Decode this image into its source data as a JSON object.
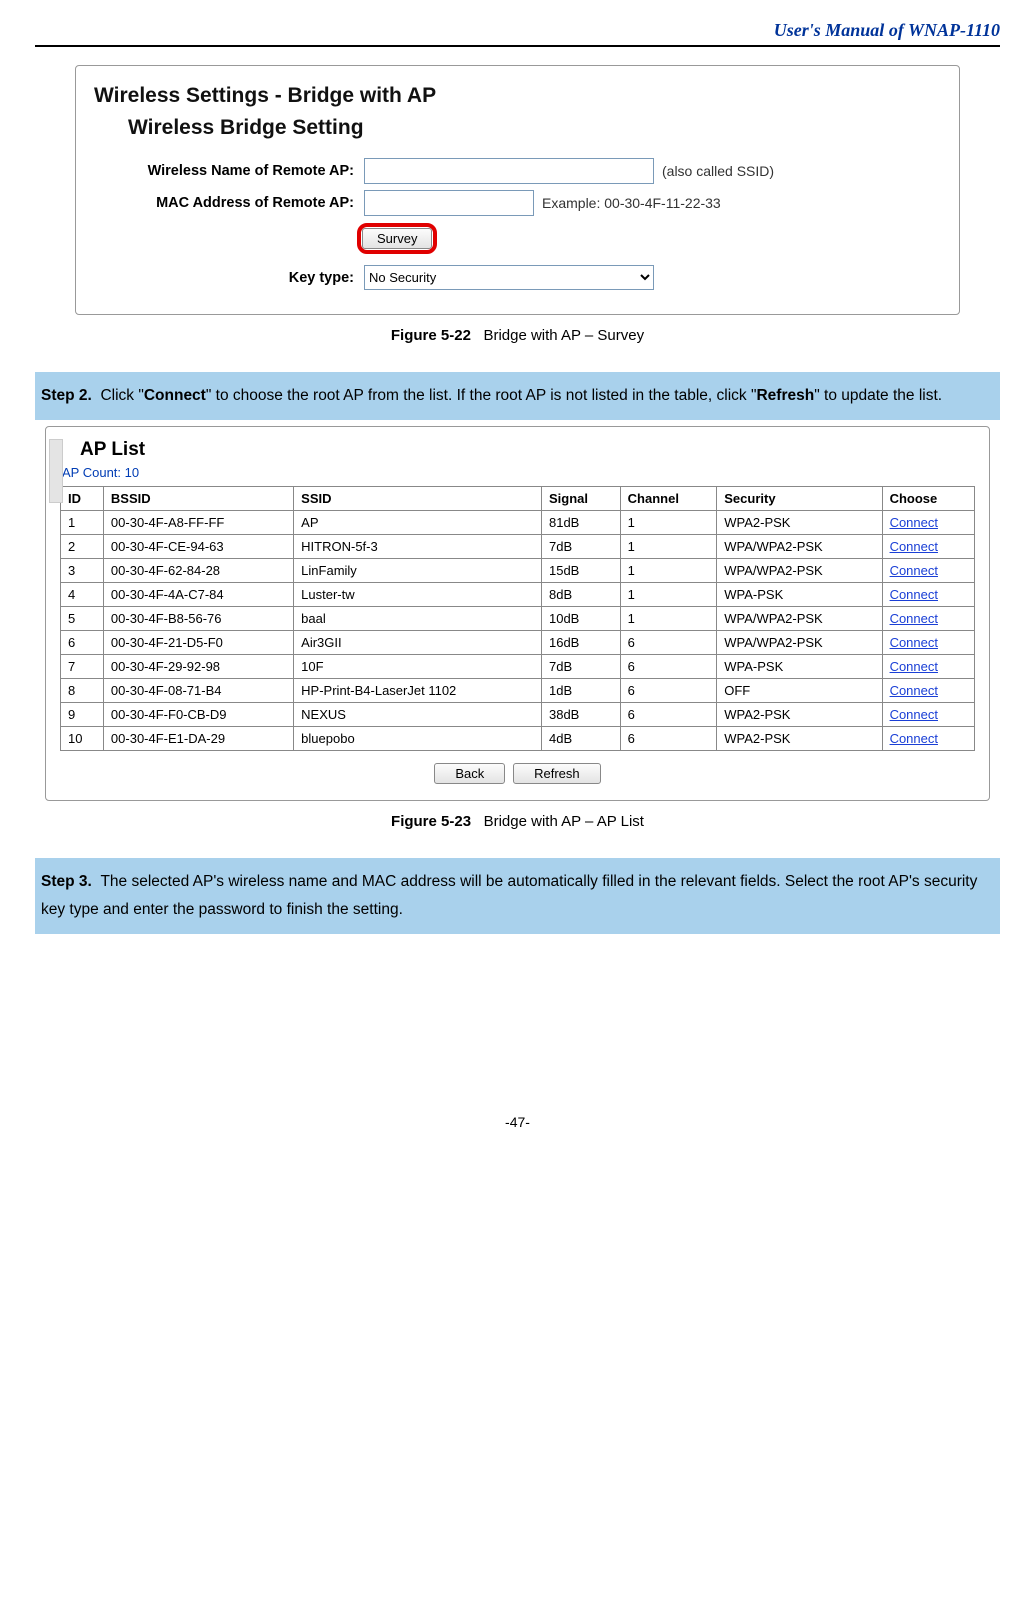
{
  "header": {
    "title": "User's Manual of WNAP-1110"
  },
  "panel1": {
    "title1": "Wireless Settings - Bridge with AP",
    "title2": "Wireless Bridge Setting",
    "row_ssid_label": "Wireless Name of Remote AP:",
    "row_ssid_hint": "(also called SSID)",
    "row_mac_label": "MAC Address of Remote AP:",
    "row_mac_hint": "Example: 00-30-4F-11-22-33",
    "survey_btn": "Survey",
    "row_key_label": "Key type:",
    "key_value": "No Security"
  },
  "caption1": {
    "label": "Figure 5-22",
    "desc": "Bridge with AP – Survey"
  },
  "step2": {
    "label": "Step 2.",
    "t1": "Click \"",
    "b1": "Connect",
    "t2": "\" to choose the root AP from the list. If the root AP is not listed in the table, click \"",
    "b2": "Refresh",
    "t3": "\" to update the list."
  },
  "panel2": {
    "title": "AP List",
    "count": "AP Count: 10",
    "headers": {
      "id": "ID",
      "bssid": "BSSID",
      "ssid": "SSID",
      "signal": "Signal",
      "channel": "Channel",
      "security": "Security",
      "choose": "Choose"
    },
    "rows": [
      {
        "id": "1",
        "bssid": "00-30-4F-A8-FF-FF",
        "ssid": "AP",
        "signal": "81dB",
        "channel": "1",
        "security": "WPA2-PSK",
        "choose": "Connect"
      },
      {
        "id": "2",
        "bssid": "00-30-4F-CE-94-63",
        "ssid": "HITRON-5f-3",
        "signal": "7dB",
        "channel": "1",
        "security": "WPA/WPA2-PSK",
        "choose": "Connect"
      },
      {
        "id": "3",
        "bssid": "00-30-4F-62-84-28",
        "ssid": "LinFamily",
        "signal": "15dB",
        "channel": "1",
        "security": "WPA/WPA2-PSK",
        "choose": "Connect"
      },
      {
        "id": "4",
        "bssid": "00-30-4F-4A-C7-84",
        "ssid": "Luster-tw",
        "signal": "8dB",
        "channel": "1",
        "security": "WPA-PSK",
        "choose": "Connect"
      },
      {
        "id": "5",
        "bssid": "00-30-4F-B8-56-76",
        "ssid": "baal",
        "signal": "10dB",
        "channel": "1",
        "security": "WPA/WPA2-PSK",
        "choose": "Connect"
      },
      {
        "id": "6",
        "bssid": "00-30-4F-21-D5-F0",
        "ssid": "Air3GII",
        "signal": "16dB",
        "channel": "6",
        "security": "WPA/WPA2-PSK",
        "choose": "Connect"
      },
      {
        "id": "7",
        "bssid": "00-30-4F-29-92-98",
        "ssid": "10F",
        "signal": "7dB",
        "channel": "6",
        "security": "WPA-PSK",
        "choose": "Connect"
      },
      {
        "id": "8",
        "bssid": "00-30-4F-08-71-B4",
        "ssid": "HP-Print-B4-LaserJet 1102",
        "signal": "1dB",
        "channel": "6",
        "security": "OFF",
        "choose": "Connect"
      },
      {
        "id": "9",
        "bssid": "00-30-4F-F0-CB-D9",
        "ssid": "NEXUS",
        "signal": "38dB",
        "channel": "6",
        "security": "WPA2-PSK",
        "choose": "Connect"
      },
      {
        "id": "10",
        "bssid": "00-30-4F-E1-DA-29",
        "ssid": "bluepobo",
        "signal": "4dB",
        "channel": "6",
        "security": "WPA2-PSK",
        "choose": "Connect"
      }
    ],
    "back_btn": "Back",
    "refresh_btn": "Refresh"
  },
  "caption2": {
    "label": "Figure 5-23",
    "desc": "Bridge with AP – AP List"
  },
  "step3": {
    "label": "Step 3.",
    "text": "The selected AP's wireless name and MAC address will be automatically filled in the relevant fields. Select the root AP's security key type and enter the password to finish the setting."
  },
  "footer": {
    "page": "-47-"
  }
}
